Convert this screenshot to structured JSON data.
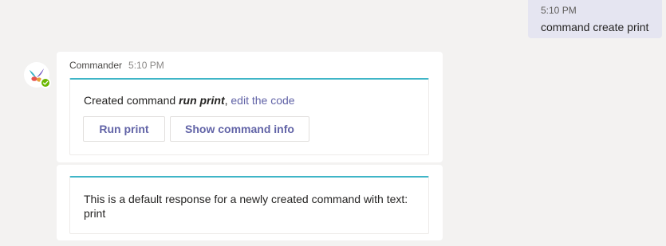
{
  "outgoing": {
    "time": "5:10 PM",
    "text": "command create print"
  },
  "incoming": {
    "sender": "Commander",
    "time": "5:10 PM",
    "card1": {
      "text_prefix": "Created command ",
      "command": "run print",
      "separator": ", ",
      "link": "edit the code",
      "buttons": [
        "Run print",
        "Show command info"
      ]
    },
    "card2": {
      "text": "This is a default response for a newly created command with text: print"
    }
  },
  "colors": {
    "background": "#f3f2f1",
    "outgoing_bubble": "#e5e5f1",
    "accent": "#6264a7",
    "card_top_border": "#3fb5c7",
    "presence": "#6bb700"
  },
  "icons": {
    "avatar": "commander-bot-logo-icon",
    "presence": "available-check-icon"
  }
}
